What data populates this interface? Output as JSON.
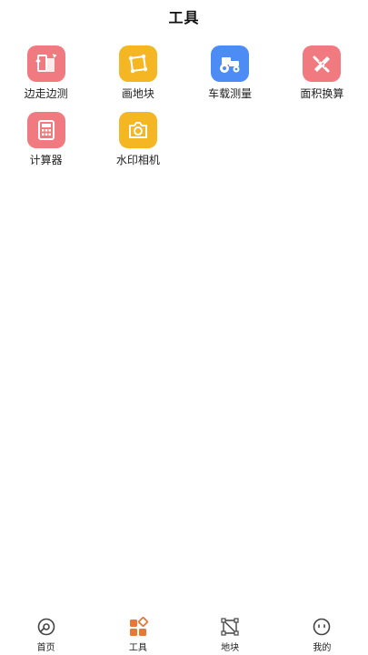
{
  "header": {
    "title": "工具"
  },
  "tools": [
    {
      "label": "边走边测",
      "icon": "walk-measure-icon",
      "color": "#f07a80"
    },
    {
      "label": "画地块",
      "icon": "draw-plot-icon",
      "color": "#f5b623"
    },
    {
      "label": "车载测量",
      "icon": "tractor-icon",
      "color": "#4d8cf5"
    },
    {
      "label": "面积换算",
      "icon": "ruler-pencil-icon",
      "color": "#f07a80"
    },
    {
      "label": "计算器",
      "icon": "calculator-icon",
      "color": "#f07a80"
    },
    {
      "label": "水印相机",
      "icon": "camera-icon",
      "color": "#f5b623"
    }
  ],
  "tabbar": {
    "items": [
      {
        "label": "首页",
        "icon": "home-icon",
        "active": false
      },
      {
        "label": "工具",
        "icon": "tools-icon",
        "active": true
      },
      {
        "label": "地块",
        "icon": "plot-icon",
        "active": false
      },
      {
        "label": "我的",
        "icon": "profile-icon",
        "active": false
      }
    ],
    "active_color": "#e8773a"
  }
}
